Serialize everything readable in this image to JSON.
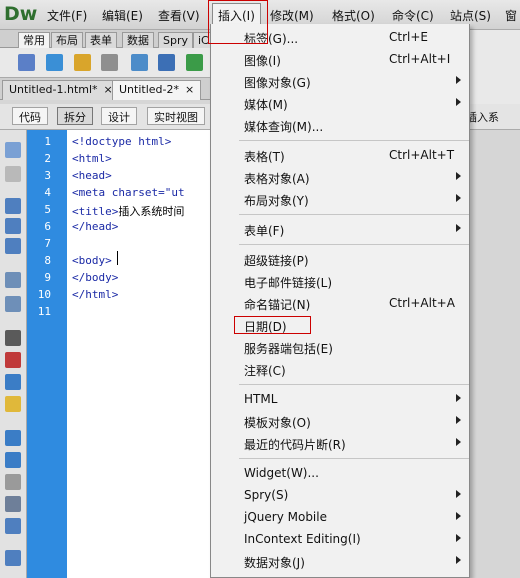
{
  "app": {
    "logo": "Dw"
  },
  "menubar": [
    {
      "label": "文件(F)"
    },
    {
      "label": "编辑(E)"
    },
    {
      "label": "查看(V)"
    },
    {
      "label": "插入(I)"
    },
    {
      "label": "修改(M)"
    },
    {
      "label": "格式(O)"
    },
    {
      "label": "命令(C)"
    },
    {
      "label": "站点(S)"
    },
    {
      "label": "窗"
    }
  ],
  "insert_tabs": [
    {
      "label": "常用"
    },
    {
      "label": "布局"
    },
    {
      "label": "表单"
    },
    {
      "label": "数据"
    },
    {
      "label": "Spry"
    },
    {
      "label": "iC"
    }
  ],
  "doc_tabs": [
    {
      "label": "Untitled-1.html*",
      "close": "×"
    },
    {
      "label": "Untitled-2*",
      "close": "×"
    }
  ],
  "view_toolbar": {
    "code": "代码",
    "split": "拆分",
    "design": "设计",
    "live": "实时视图",
    "title_label": "插入系"
  },
  "editor": {
    "line_numbers": [
      "1",
      "2",
      "3",
      "4",
      "5",
      "6",
      "7",
      "8",
      "9",
      "10",
      "11"
    ],
    "lines": [
      "<!doctype html>",
      "<html>",
      "<head>",
      "<meta charset=\"ut",
      "<title>",
      "</head>",
      "",
      "<body>",
      "</body>",
      "</html>",
      ""
    ],
    "title_text": "插入系统时间"
  },
  "insert_menu": {
    "items": [
      {
        "label": "标签(G)...",
        "shortcut": "Ctrl+E"
      },
      {
        "label": "图像(I)",
        "shortcut": "Ctrl+Alt+I"
      },
      {
        "label": "图像对象(G)",
        "submenu": true
      },
      {
        "label": "媒体(M)",
        "submenu": true
      },
      {
        "label": "媒体查询(M)..."
      },
      {
        "label": "表格(T)",
        "shortcut": "Ctrl+Alt+T"
      },
      {
        "label": "表格对象(A)",
        "submenu": true
      },
      {
        "label": "布局对象(Y)",
        "submenu": true
      },
      {
        "label": "表单(F)",
        "submenu": true
      },
      {
        "label": "超级链接(P)"
      },
      {
        "label": "电子邮件链接(L)"
      },
      {
        "label": "命名锚记(N)",
        "shortcut": "Ctrl+Alt+A"
      },
      {
        "label": "日期(D)"
      },
      {
        "label": "服务器端包括(E)"
      },
      {
        "label": "注释(C)"
      },
      {
        "label": "HTML",
        "submenu": true
      },
      {
        "label": "模板对象(O)",
        "submenu": true
      },
      {
        "label": "最近的代码片断(R)",
        "submenu": true
      },
      {
        "label": "Widget(W)..."
      },
      {
        "label": "Spry(S)",
        "submenu": true
      },
      {
        "label": "jQuery Mobile",
        "submenu": true
      },
      {
        "label": "InContext Editing(I)",
        "submenu": true
      },
      {
        "label": "数据对象(J)",
        "submenu": true
      }
    ]
  },
  "colors": {
    "gutter": "#2f8be0",
    "highlight_box": "#cc0000",
    "code_tag": "#1b2aa6"
  }
}
